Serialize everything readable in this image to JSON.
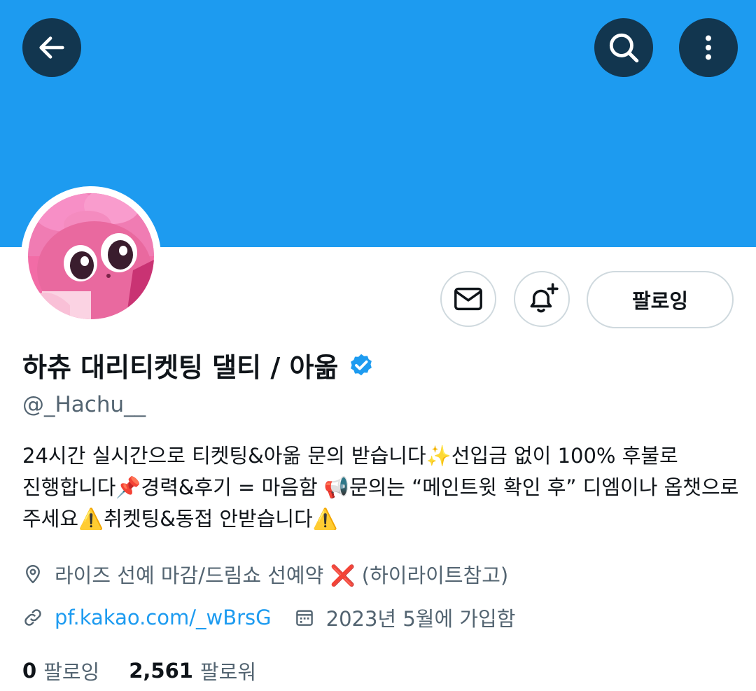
{
  "header": {
    "back_icon": "arrow-left-icon",
    "search_icon": "search-icon",
    "more_icon": "more-vertical-icon",
    "banner_color": "#1d9bf0"
  },
  "profile": {
    "display_name": "하츄 대리티켓팅 댈티 / 아옮",
    "verified": true,
    "verified_color": "#1d9bf0",
    "handle": "@_Hachu__",
    "avatar_icon": "pink-character-avatar"
  },
  "actions": {
    "message_icon": "envelope-icon",
    "notify_icon": "bell-plus-icon",
    "follow_label": "팔로잉"
  },
  "bio": {
    "lines": [
      "24시간 실시간으로 티켓팅&아옮 문의 받습니다✨선입금 없이 100% 후불로",
      "진행합니다📌경력&후기 = 마음함 📢문의는 “메인트윗 확인 후” 디엠이나 옵챗으로",
      "주세요⚠️취켓팅&동접 안받습니다⚠️"
    ]
  },
  "meta": {
    "location_icon": "location-pin-icon",
    "location": "라이즈 선예 마감/드림쇼 선예약 ❌ (하이라이트참고)",
    "link_icon": "link-icon",
    "link": "pf.kakao.com/_wBrsG",
    "calendar_icon": "calendar-icon",
    "joined": "2023년 5월에 가입함"
  },
  "stats": {
    "following_count": "0",
    "following_label": "팔로잉",
    "followers_count": "2,561",
    "followers_label": "팔로워"
  }
}
